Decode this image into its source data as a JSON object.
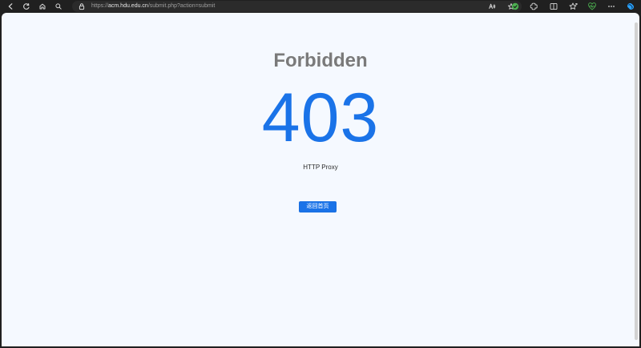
{
  "browser": {
    "url": {
      "scheme": "https://",
      "host": "acm.hdu.edu.cn",
      "path": "/submit.php?action=submit"
    }
  },
  "page": {
    "title": "Forbidden",
    "code": "403",
    "subtitle": "HTTP Proxy",
    "home_button_label": "返回首页"
  }
}
